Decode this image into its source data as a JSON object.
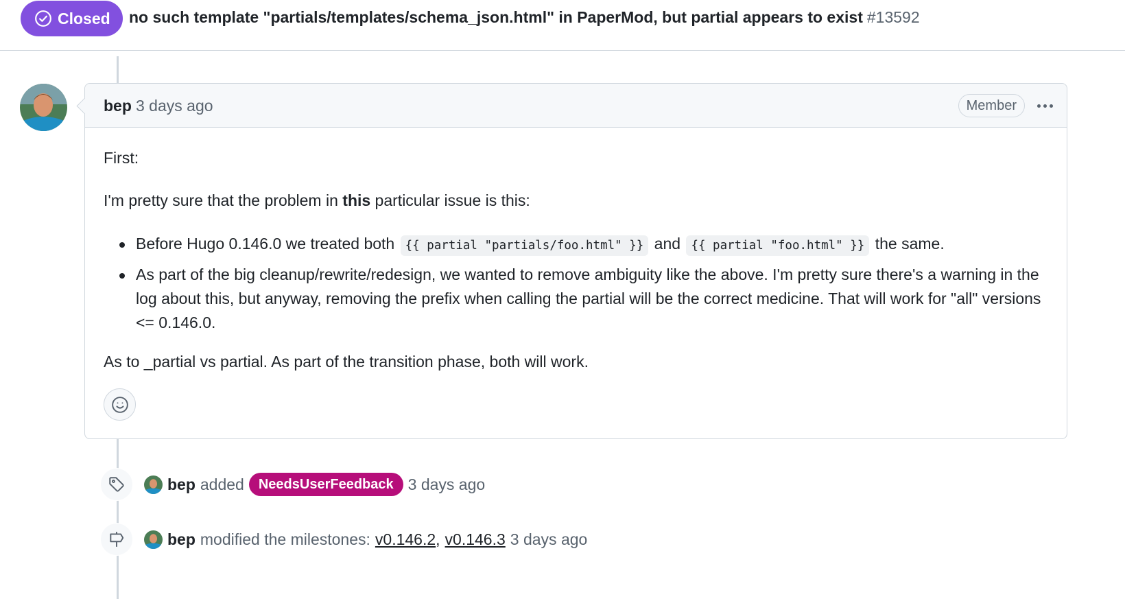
{
  "issue": {
    "state": "Closed",
    "title": "no such template \"partials/templates/schema_json.html\" in PaperMod, but partial appears to exist",
    "number": "#13592"
  },
  "comment": {
    "author": "bep",
    "time": "3 days ago",
    "role": "Member",
    "p1": "First:",
    "p2_before": "I'm pretty sure that the problem in ",
    "p2_bold": "this",
    "p2_after": " particular issue is this:",
    "li1_before": "Before Hugo 0.146.0 we treated both ",
    "li1_code1": "{{ partial \"partials/foo.html\" }}",
    "li1_mid": " and ",
    "li1_code2": "{{ partial \"foo.html\" }}",
    "li1_after": " the same.",
    "li2": "As part of the big cleanup/rewrite/redesign, we wanted to remove ambiguity like the above. I'm pretty sure there's a warning in the log about this, but anyway, removing the prefix when calling the partial will be the correct medicine. That will work for \"all\" versions <= 0.146.0.",
    "p3": "As to _partial vs partial. As part of the transition phase, both will work."
  },
  "events": {
    "label_event": {
      "author": "bep",
      "action": "added",
      "label": "NeedsUserFeedback",
      "label_color": "#b60e7a",
      "time": "3 days ago"
    },
    "milestone_event": {
      "author": "bep",
      "action": "modified the milestones:",
      "milestone1": "v0.146.2",
      "separator": ",",
      "milestone2": "v0.146.3",
      "time": "3 days ago"
    }
  },
  "icons": {
    "state": "check-circle-icon",
    "reaction": "smiley-icon",
    "label": "tag-icon",
    "milestone": "milestone-icon",
    "more": "kebab-horizontal-icon"
  },
  "colors": {
    "closed_purple": "#8250df",
    "label_magenta": "#b60e7a"
  }
}
